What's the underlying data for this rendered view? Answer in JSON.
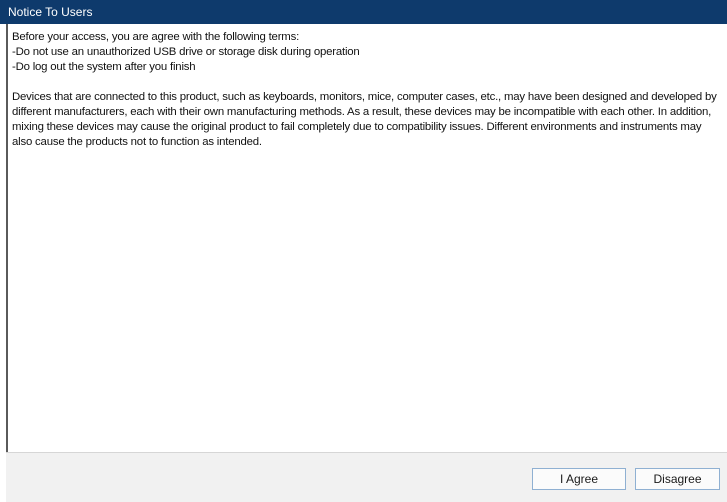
{
  "window": {
    "title": "Notice To Users"
  },
  "notice": {
    "intro": "Before your access, you are agree with the following terms:",
    "terms": [
      "-Do not use an unauthorized USB drive or storage disk during operation",
      "-Do log out the system after you finish"
    ],
    "paragraph": "Devices that are connected to this product, such as keyboards, monitors, mice, computer cases, etc., may have been designed and developed by different manufacturers, each with their own manufacturing methods. As a result, these devices may be incompatible with each other. In addition, mixing these devices may cause the original product to fail completely due to compatibility issues. Different environments and instruments may also cause the products not to function as intended."
  },
  "buttons": {
    "agree_label": "I Agree",
    "disagree_label": "Disagree"
  },
  "colors": {
    "titlebar": "#0e3a6c",
    "footer": "#f1f1f1",
    "button_border": "#8fb0d2"
  }
}
